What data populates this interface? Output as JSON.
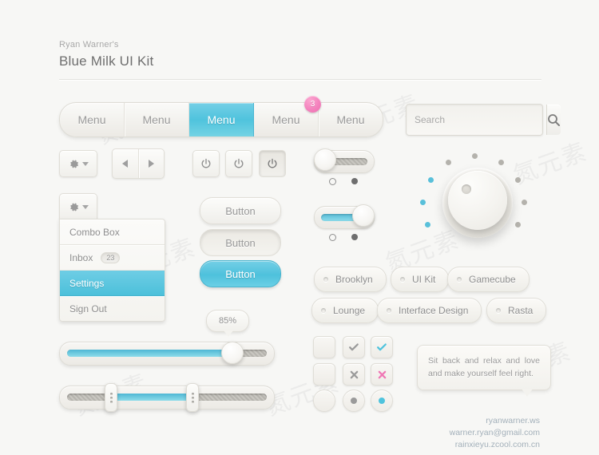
{
  "header": {
    "subtitle": "Ryan Warner's",
    "title": "Blue Milk UI Kit"
  },
  "menubar": {
    "items": [
      {
        "label": "Menu",
        "active": false
      },
      {
        "label": "Menu",
        "active": false
      },
      {
        "label": "Menu",
        "active": true
      },
      {
        "label": "Menu",
        "active": false,
        "badge": "3"
      },
      {
        "label": "Menu",
        "active": false
      }
    ],
    "badge_color": "#ef77b5",
    "active_color": "#4fc3dd"
  },
  "search": {
    "placeholder": "Search",
    "value": "",
    "icon": "search-icon"
  },
  "toolbar": {
    "gear_icon": "gear-icon",
    "caret_icon": "chevron-down-icon",
    "prev_icon": "triangle-left-icon",
    "next_icon": "triangle-right-icon",
    "power_icon": "power-icon",
    "power_buttons": [
      {
        "state": "normal"
      },
      {
        "state": "normal"
      },
      {
        "state": "pressed"
      }
    ]
  },
  "dropdown": {
    "items": [
      {
        "label": "Combo Box",
        "selected": false
      },
      {
        "label": "Inbox",
        "count": "23",
        "selected": false
      },
      {
        "label": "Settings",
        "selected": true
      },
      {
        "label": "Sign Out",
        "selected": false
      }
    ]
  },
  "pill_buttons": [
    {
      "label": "Button",
      "state": "normal"
    },
    {
      "label": "Button",
      "state": "pressed"
    },
    {
      "label": "Button",
      "state": "active"
    }
  ],
  "toggles": [
    {
      "state": "off"
    },
    {
      "state": "on"
    }
  ],
  "knob": {
    "dots_total": 9,
    "dots_active": 3,
    "active_color": "#59c0da",
    "inactive_color": "#b4b2ac"
  },
  "tags": [
    {
      "label": "Brooklyn"
    },
    {
      "label": "UI Kit"
    },
    {
      "label": "Gamecube"
    },
    {
      "label": "Lounge"
    },
    {
      "label": "Interface Design"
    },
    {
      "label": "Rasta"
    }
  ],
  "sliders": {
    "tooltip": "85%",
    "single": {
      "value": 85
    },
    "range": {
      "start": 23,
      "end": 62
    }
  },
  "checkbox_grid": [
    {
      "name": "checkbox-empty",
      "shape": "square",
      "mark": "",
      "color": ""
    },
    {
      "name": "checkbox-checked-gray",
      "shape": "square",
      "mark": "check",
      "color": "#9a9a9a"
    },
    {
      "name": "checkbox-checked-blue",
      "shape": "square",
      "mark": "check",
      "color": "#4fc3dd"
    },
    {
      "name": "checkbox-empty",
      "shape": "square",
      "mark": "",
      "color": ""
    },
    {
      "name": "checkbox-x-gray",
      "shape": "square",
      "mark": "x",
      "color": "#9a9a9a"
    },
    {
      "name": "checkbox-x-pink",
      "shape": "square",
      "mark": "x",
      "color": "#ef77b5"
    },
    {
      "name": "radio-empty",
      "shape": "round",
      "mark": "",
      "color": ""
    },
    {
      "name": "radio-selected-gray",
      "shape": "round",
      "mark": "dot",
      "color": "#9a9a9a"
    },
    {
      "name": "radio-selected-blue",
      "shape": "round",
      "mark": "dot",
      "color": "#4fc3dd"
    }
  ],
  "bubble": {
    "text": "Sit back and relax and love and make yourself feel right."
  },
  "footer": {
    "line1": "ryanwarner.ws",
    "line2": "warner.ryan@gmail.com",
    "line3": "rainxieyu.zcool.com.cn"
  }
}
